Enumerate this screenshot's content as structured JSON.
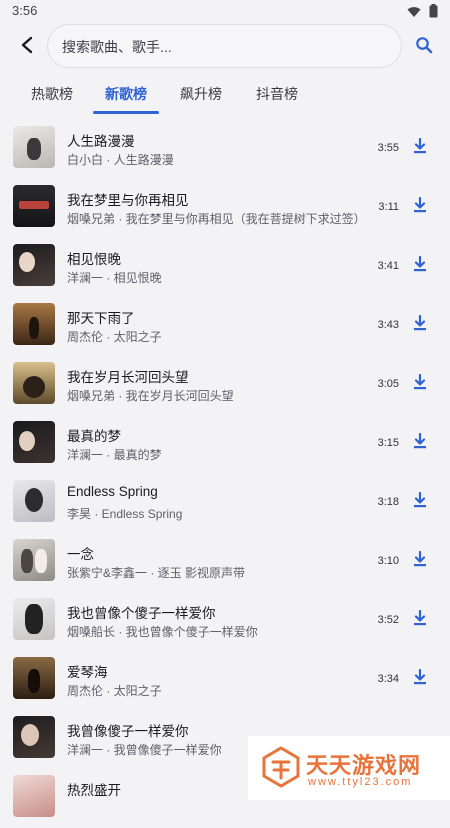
{
  "status": {
    "time": "3:56"
  },
  "search": {
    "placeholder": "搜索歌曲、歌手..."
  },
  "tabs": [
    {
      "label": "热歌榜",
      "active": false
    },
    {
      "label": "新歌榜",
      "active": true
    },
    {
      "label": "飙升榜",
      "active": false
    },
    {
      "label": "抖音榜",
      "active": false
    }
  ],
  "songs": [
    {
      "title": "人生路漫漫",
      "subtitle": "白小白 · 人生路漫漫",
      "duration": "3:55"
    },
    {
      "title": "我在梦里与你再相见",
      "subtitle": "烟嗓兄弟 · 我在梦里与你再相见（我在菩提树下求过签）",
      "duration": "3:11"
    },
    {
      "title": "相见恨晚",
      "subtitle": "洋澜一 · 相见恨晚",
      "duration": "3:41"
    },
    {
      "title": "那天下雨了",
      "subtitle": "周杰伦 · 太阳之子",
      "duration": "3:43"
    },
    {
      "title": "我在岁月长河回头望",
      "subtitle": "烟嗓兄弟 · 我在岁月长河回头望",
      "duration": "3:05"
    },
    {
      "title": "最真的梦",
      "subtitle": "洋澜一 · 最真的梦",
      "duration": "3:15"
    },
    {
      "title": "Endless Spring",
      "subtitle": "李昊 · Endless Spring",
      "duration": "3:18"
    },
    {
      "title": "一念",
      "subtitle": "张紫宁&李鑫一 · 逐玉 影视原声带",
      "duration": "3:10"
    },
    {
      "title": "我也曾像个傻子一样爱你",
      "subtitle": "烟嗓船长 · 我也曾像个傻子一样爱你",
      "duration": "3:52"
    },
    {
      "title": "爱琴海",
      "subtitle": "周杰伦 · 太阳之子",
      "duration": "3:34"
    },
    {
      "title": "我曾像傻子一样爱你",
      "subtitle": "洋澜一 · 我曾像傻子一样爱你",
      "duration": ""
    },
    {
      "title": "热烈盛开",
      "subtitle": "",
      "duration": ""
    }
  ],
  "watermark": {
    "text": "天天游戏网",
    "url": "www.ttyl23.com"
  },
  "colors": {
    "accent": "#2f63d3",
    "background": "#f3f3f6",
    "watermark": "#e8743b"
  }
}
